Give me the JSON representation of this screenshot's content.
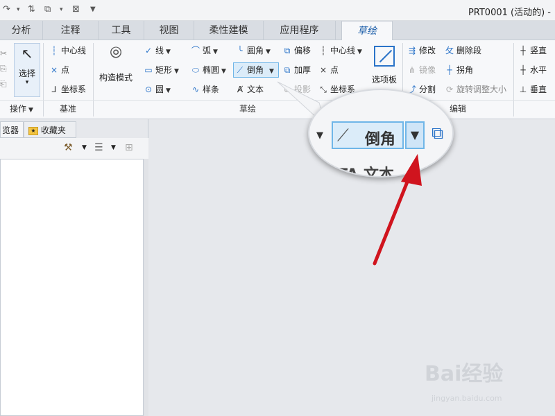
{
  "window": {
    "title": "PRT0001 (活动的) -"
  },
  "tabs": [
    "分析",
    "注释",
    "工具",
    "视图",
    "柔性建模",
    "应用程序",
    "草绘"
  ],
  "ribbon": {
    "operations": {
      "label": "操作",
      "select": "选择"
    },
    "datum": {
      "label": "基准",
      "items": [
        "中心线",
        "点",
        "坐标系"
      ]
    },
    "sketch": {
      "label": "草绘",
      "construction_mode": "构造模式",
      "col1": [
        "线",
        "矩形",
        "圆"
      ],
      "col2": [
        "弧",
        "椭圆",
        "样条"
      ],
      "col3": [
        "圆角",
        "倒角",
        "文本"
      ],
      "col4": [
        "偏移",
        "加厚",
        "投影"
      ],
      "col5": [
        "中心线",
        "点",
        "坐标系"
      ],
      "palette": "选项板"
    },
    "edit": {
      "label": "编辑",
      "col1": [
        "修改",
        "镜像",
        "分割"
      ],
      "col2": [
        "删除段",
        "拐角",
        "旋转调整大小"
      ]
    },
    "constraints": {
      "items": [
        "竖直",
        "水平",
        "垂直"
      ]
    }
  },
  "panel": {
    "tabs": [
      "览器",
      "收藏夹"
    ]
  },
  "zoom": {
    "label": "倒角",
    "below": "文本"
  },
  "watermark": {
    "brand": "Bai经验",
    "url": "jingyan.baidu.com"
  }
}
